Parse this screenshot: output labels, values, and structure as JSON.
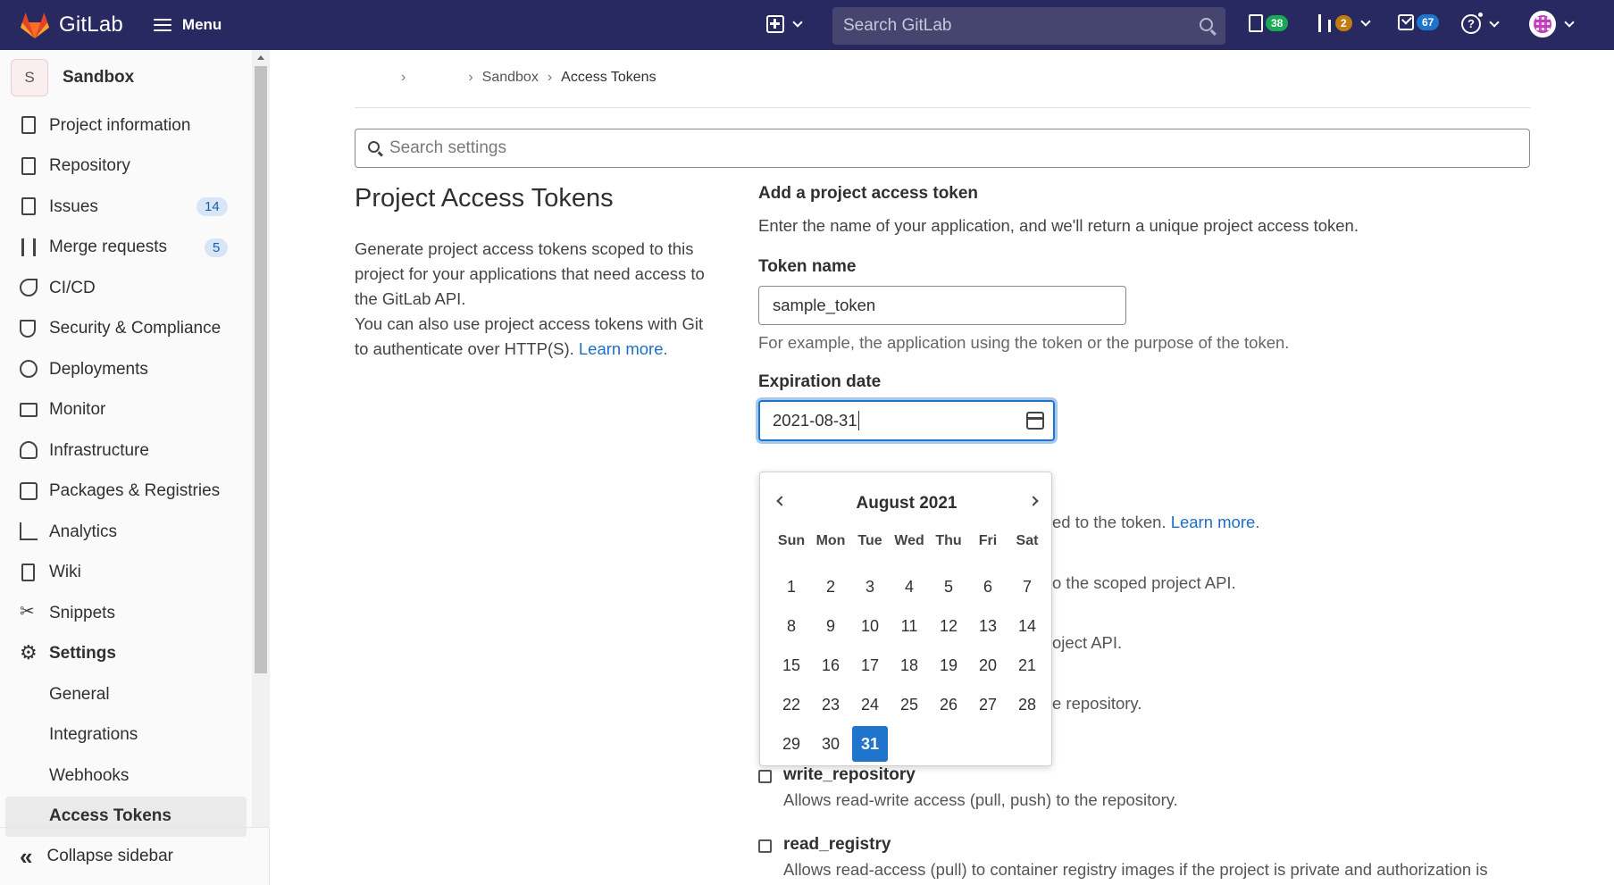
{
  "topbar": {
    "brand": "GitLab",
    "menu_label": "Menu",
    "search_placeholder": "Search GitLab",
    "issues_count": "38",
    "mr_count": "2",
    "todos_count": "67",
    "colors": {
      "bg": "#292961",
      "issues": "#1aaa55",
      "mr": "#c17d10",
      "todos": "#1f75cb"
    }
  },
  "sidebar": {
    "project_initial": "S",
    "project_name": "Sandbox",
    "items": [
      {
        "label": "Project information",
        "icon": "project-info-icon"
      },
      {
        "label": "Repository",
        "icon": "repository-icon"
      },
      {
        "label": "Issues",
        "icon": "issues-icon",
        "count": "14"
      },
      {
        "label": "Merge requests",
        "icon": "merge-request-icon",
        "count": "5"
      },
      {
        "label": "CI/CD",
        "icon": "rocket-icon"
      },
      {
        "label": "Security & Compliance",
        "icon": "shield-icon"
      },
      {
        "label": "Deployments",
        "icon": "deployments-icon"
      },
      {
        "label": "Monitor",
        "icon": "monitor-icon"
      },
      {
        "label": "Infrastructure",
        "icon": "cloud-icon"
      },
      {
        "label": "Packages & Registries",
        "icon": "package-icon"
      },
      {
        "label": "Analytics",
        "icon": "chart-icon"
      },
      {
        "label": "Wiki",
        "icon": "book-icon"
      },
      {
        "label": "Snippets",
        "icon": "scissors-icon"
      },
      {
        "label": "Settings",
        "icon": "gear-icon"
      }
    ],
    "settings_sub": [
      "General",
      "Integrations",
      "Webhooks",
      "Access Tokens"
    ],
    "collapse_label": "Collapse sidebar"
  },
  "breadcrumb": {
    "project": "Sandbox",
    "current": "Access Tokens"
  },
  "settings_search_placeholder": "Search settings",
  "intro": {
    "title": "Project Access Tokens",
    "para1": "Generate project access tokens scoped to this project for your applications that need access to the GitLab API.",
    "para2": "You can also use project access tokens with Git to authenticate over HTTP(S).",
    "learn_more": "Learn more."
  },
  "form": {
    "heading": "Add a project access token",
    "description": "Enter the name of your application, and we'll return a unique project access token.",
    "token_name_label": "Token name",
    "token_name_value": "sample_token",
    "token_name_help": "For example, the application using the token or the purpose of the token.",
    "expiration_label": "Expiration date",
    "expiration_value": "2021-08-31",
    "partial_scopes_help": "ed to the token.",
    "partial_scopes_link": "Learn more.",
    "partial_api": "o the scoped project API.",
    "partial_read_api": "oject API.",
    "partial_read_repo": "e repository.",
    "scopes": [
      {
        "name": "write_repository",
        "desc": "Allows read-write access (pull, push) to the repository."
      },
      {
        "name": "read_registry",
        "desc": "Allows read-access (pull) to container registry images if the project is private and authorization is"
      }
    ]
  },
  "datepicker": {
    "month_year": "August  2021",
    "weekdays": [
      "Sun",
      "Mon",
      "Tue",
      "Wed",
      "Thu",
      "Fri",
      "Sat"
    ],
    "days": [
      "1",
      "2",
      "3",
      "4",
      "5",
      "6",
      "7",
      "8",
      "9",
      "10",
      "11",
      "12",
      "13",
      "14",
      "15",
      "16",
      "17",
      "18",
      "19",
      "20",
      "21",
      "22",
      "23",
      "24",
      "25",
      "26",
      "27",
      "28",
      "29",
      "30",
      "31"
    ],
    "selected": "31"
  }
}
